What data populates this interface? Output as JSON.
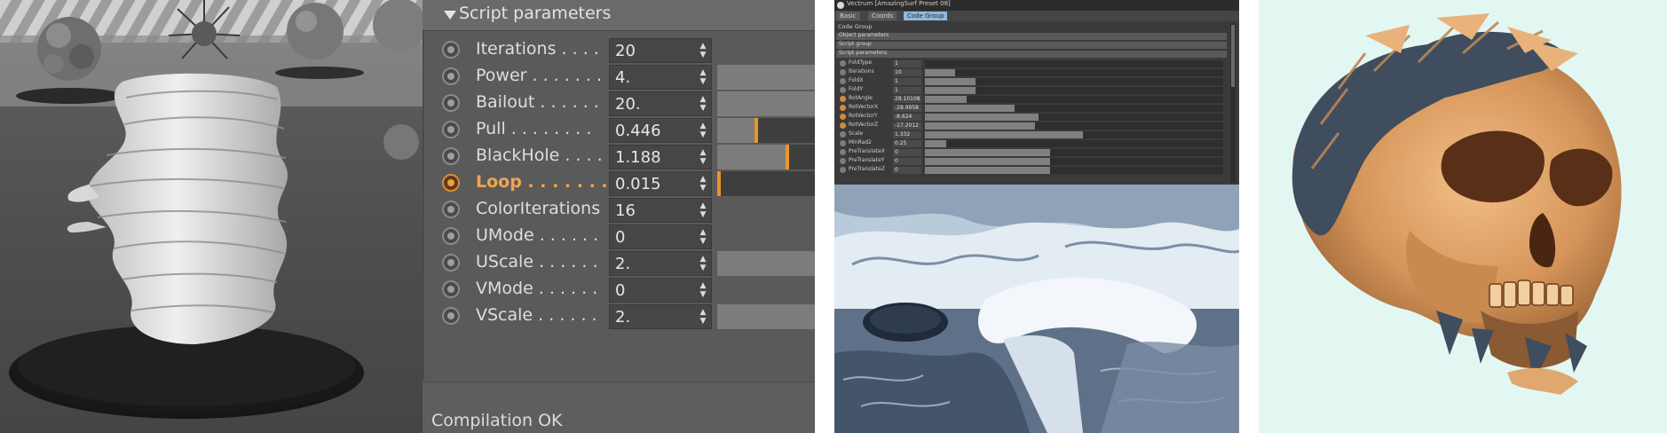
{
  "panel_left": {
    "image": "fractal-render-grey"
  },
  "script_panel": {
    "header": "Script parameters",
    "params": [
      {
        "name": "Iterations . . . .",
        "value": "20",
        "slider": "none"
      },
      {
        "name": "Power . . . . . . .",
        "value": "4.",
        "slider": "full"
      },
      {
        "name": "Bailout . . . . . .",
        "value": "20.",
        "slider": "full"
      },
      {
        "name": "Pull . . . . . . . .",
        "value": "0.446",
        "slider": "partial",
        "level": 0.4
      },
      {
        "name": "BlackHole . . . .",
        "value": "1.188",
        "slider": "partial",
        "level": 0.72
      },
      {
        "name": "Loop . . . . . . .",
        "value": "0.015",
        "slider": "dark",
        "level": 0.02,
        "active": true
      },
      {
        "name": "ColorIterations",
        "value": "16",
        "slider": "none"
      },
      {
        "name": "UMode . . . . . .",
        "value": "0",
        "slider": "none"
      },
      {
        "name": "UScale . . . . . .",
        "value": "2.",
        "slider": "full"
      },
      {
        "name": "VMode . . . . . .",
        "value": "0",
        "slider": "none"
      },
      {
        "name": "VScale . . . . . .",
        "value": "2.",
        "slider": "full"
      }
    ],
    "status": "Compilation OK",
    "accent_color": "#e8952e"
  },
  "mini_window": {
    "title": "Vectrum [AmazingSurf Preset 08]",
    "tabs": [
      "Basic",
      "Coords",
      "Code Group"
    ],
    "selected_tab": "Code Group",
    "group_label": "Code Group",
    "groups": [
      "Object parameters",
      "Script group",
      "Script parameters"
    ],
    "rows": [
      {
        "name": "FoldType",
        "value": "1",
        "level": 0
      },
      {
        "name": "Iterations",
        "value": "10",
        "level": 0.1
      },
      {
        "name": "FoldX",
        "value": "1",
        "level": 0.17
      },
      {
        "name": "FoldY",
        "value": "1",
        "level": 0.17
      },
      {
        "name": "RotAngle",
        "value": "28.10108",
        "level": 0.14,
        "hot": true
      },
      {
        "name": "RotVectorX",
        "value": "-28.9958",
        "level": 0.3,
        "hot": true
      },
      {
        "name": "RotVectorY",
        "value": "-8.624",
        "level": 0.38,
        "hot": true
      },
      {
        "name": "RotVectorZ",
        "value": "-17.2012",
        "level": 0.37,
        "hot": true
      },
      {
        "name": "Scale",
        "value": "1.332",
        "level": 0.53
      },
      {
        "name": "MinRad2",
        "value": "0.25",
        "level": 0.07
      },
      {
        "name": "PreTranslateX",
        "value": "0",
        "level": 0.42
      },
      {
        "name": "PreTranslateY",
        "value": "0",
        "level": 0.42
      },
      {
        "name": "PreTranslateZ",
        "value": "0",
        "level": 0.42
      }
    ],
    "render": "icy-fractal-landscape"
  },
  "panel_right": {
    "image": "fractal-skull-render",
    "background": "#e2f7f2"
  }
}
